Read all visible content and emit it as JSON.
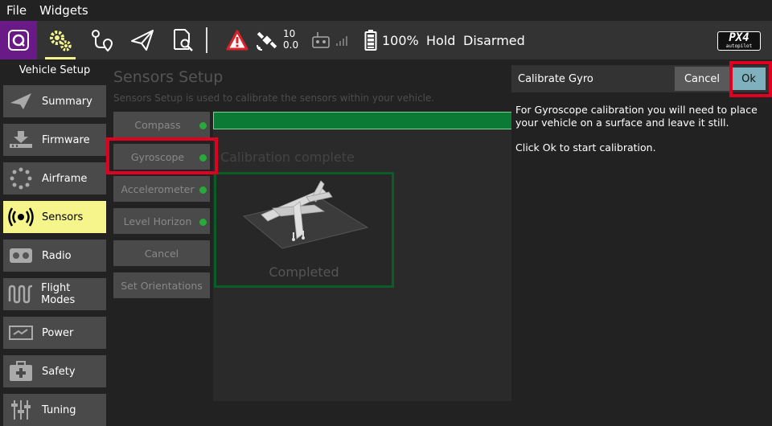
{
  "menu": {
    "file": "File",
    "widgets": "Widgets"
  },
  "toolbar": {
    "gps_sat_count": "10",
    "gps_hdop": "0.0",
    "battery": "100%",
    "flight_mode": "Hold",
    "arm_status": "Disarmed",
    "logo_text": "PX4",
    "logo_sub": "autopilot"
  },
  "sidebar": {
    "title": "Vehicle Setup",
    "items": [
      {
        "label": "Summary",
        "icon": "paper-plane-icon"
      },
      {
        "label": "Firmware",
        "icon": "download-icon"
      },
      {
        "label": "Airframe",
        "icon": "airframe-icon"
      },
      {
        "label": "Sensors",
        "icon": "sensors-icon"
      },
      {
        "label": "Radio",
        "icon": "radio-icon"
      },
      {
        "label": "Flight Modes",
        "icon": "flight-modes-icon"
      },
      {
        "label": "Power",
        "icon": "power-icon"
      },
      {
        "label": "Safety",
        "icon": "safety-icon"
      },
      {
        "label": "Tuning",
        "icon": "tuning-icon"
      }
    ]
  },
  "main": {
    "title": "Sensors Setup",
    "description": "Sensors Setup is used to calibrate the sensors within your vehicle.",
    "calibration_status": "Calibration complete",
    "completed_label": "Completed",
    "progress": 1.0,
    "sensors": [
      {
        "label": "Compass"
      },
      {
        "label": "Gyroscope"
      },
      {
        "label": "Accelerometer"
      },
      {
        "label": "Level Horizon"
      },
      {
        "label": "Cancel"
      },
      {
        "label": "Set Orientations"
      }
    ]
  },
  "dialog": {
    "title": "Calibrate Gyro",
    "cancel_label": "Cancel",
    "ok_label": "Ok",
    "body1": "For Gyroscope calibration you will need to place your vehicle on a surface and leave it still.",
    "body2": "Click Ok to start calibration."
  },
  "colors": {
    "accent": "#f5f58c",
    "logo_bg": "#6a1a87",
    "progress": "#0b7a34",
    "ok_button": "#7fb0bd",
    "highlight": "#e00020",
    "status_dot": "#2aa83a"
  }
}
